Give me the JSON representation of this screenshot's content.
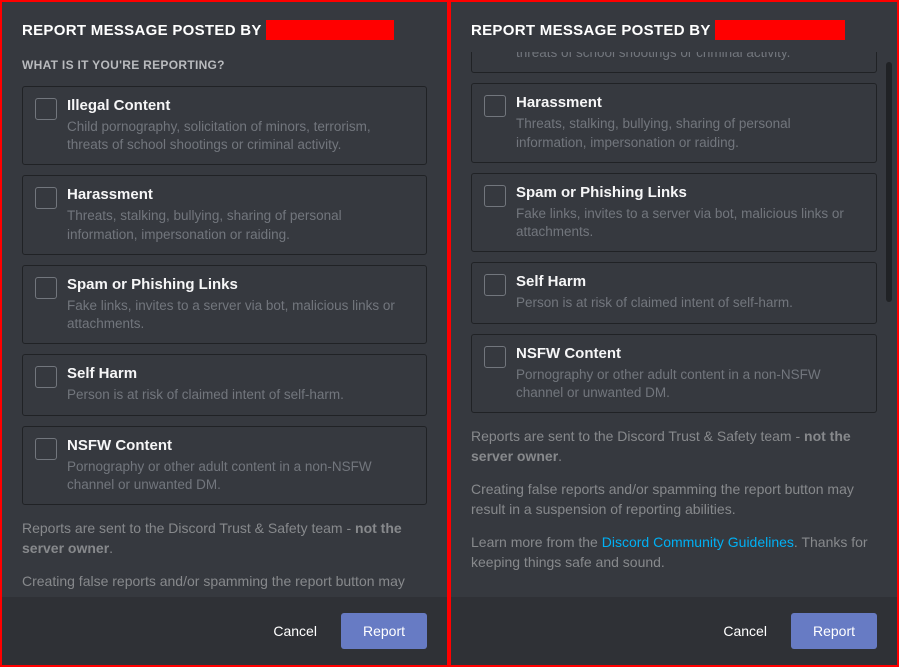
{
  "header_title": "REPORT MESSAGE POSTED BY",
  "subhead": "WHAT IS IT YOU'RE REPORTING?",
  "options": [
    {
      "title": "Illegal Content",
      "desc": "Child pornography, solicitation of minors, terrorism, threats of school shootings or criminal activity."
    },
    {
      "title": "Harassment",
      "desc": "Threats, stalking, bullying, sharing of personal information, impersonation or raiding."
    },
    {
      "title": "Spam or Phishing Links",
      "desc": "Fake links, invites to a server via bot, malicious links or attachments."
    },
    {
      "title": "Self Harm",
      "desc": "Person is at risk of claimed intent of self-harm."
    },
    {
      "title": "NSFW Content",
      "desc": "Pornography or other adult content in a non-NSFW channel or unwanted DM."
    }
  ],
  "info1_a": "Reports are sent to the Discord Trust & Safety team - ",
  "info1_b": "not the server owner",
  "info1_c": ".",
  "info2": "Creating false reports and/or spamming the report button may result in a suspension of reporting abilities.",
  "info2_trunc": "Creating false reports and/or spamming the report button may",
  "info3_a": "Learn more from the ",
  "info3_link": "Discord Community Guidelines",
  "info3_b": ". Thanks for keeping things safe and sound.",
  "cancel": "Cancel",
  "report": "Report"
}
